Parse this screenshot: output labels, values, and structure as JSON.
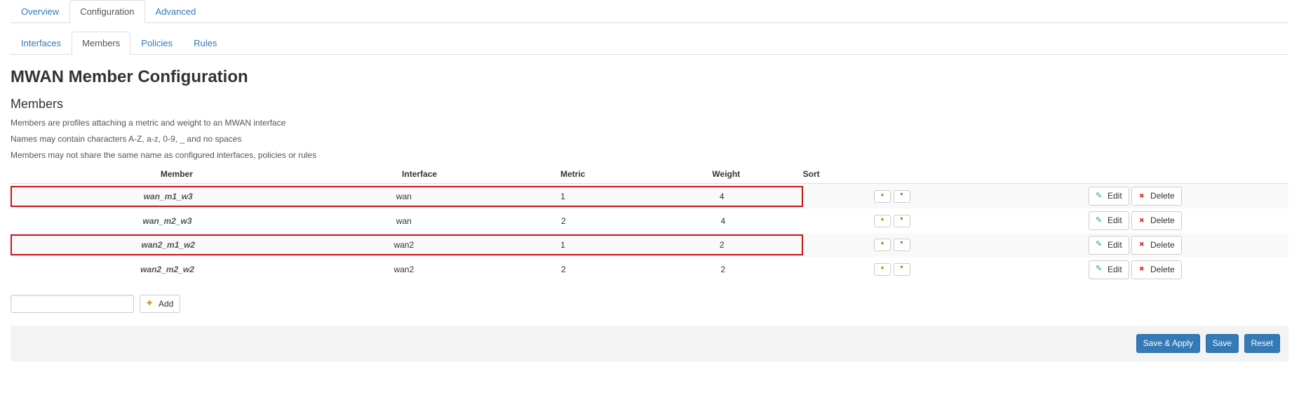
{
  "top_tabs": [
    {
      "label": "Overview",
      "active": false
    },
    {
      "label": "Configuration",
      "active": true
    },
    {
      "label": "Advanced",
      "active": false
    }
  ],
  "sub_tabs": [
    {
      "label": "Interfaces",
      "active": false
    },
    {
      "label": "Members",
      "active": true
    },
    {
      "label": "Policies",
      "active": false
    },
    {
      "label": "Rules",
      "active": false
    }
  ],
  "page_title": "MWAN Member Configuration",
  "section_title": "Members",
  "description": [
    "Members are profiles attaching a metric and weight to an MWAN interface",
    "Names may contain characters A-Z, a-z, 0-9, _ and no spaces",
    "Members may not share the same name as configured interfaces, policies or rules"
  ],
  "columns": {
    "member": "Member",
    "interface": "Interface",
    "metric": "Metric",
    "weight": "Weight",
    "sort": "Sort"
  },
  "rows": [
    {
      "name": "wan_m1_w3",
      "iface": "wan",
      "metric": "1",
      "weight": "4",
      "highlight": true
    },
    {
      "name": "wan_m2_w3",
      "iface": "wan",
      "metric": "2",
      "weight": "4",
      "highlight": false
    },
    {
      "name": "wan2_m1_w2",
      "iface": "wan2",
      "metric": "1",
      "weight": "2",
      "highlight": true
    },
    {
      "name": "wan2_m2_w2",
      "iface": "wan2",
      "metric": "2",
      "weight": "2",
      "highlight": false
    }
  ],
  "buttons": {
    "edit": "Edit",
    "delete": "Delete",
    "add": "Add",
    "save_apply": "Save & Apply",
    "save": "Save",
    "reset": "Reset"
  },
  "add_input_value": ""
}
